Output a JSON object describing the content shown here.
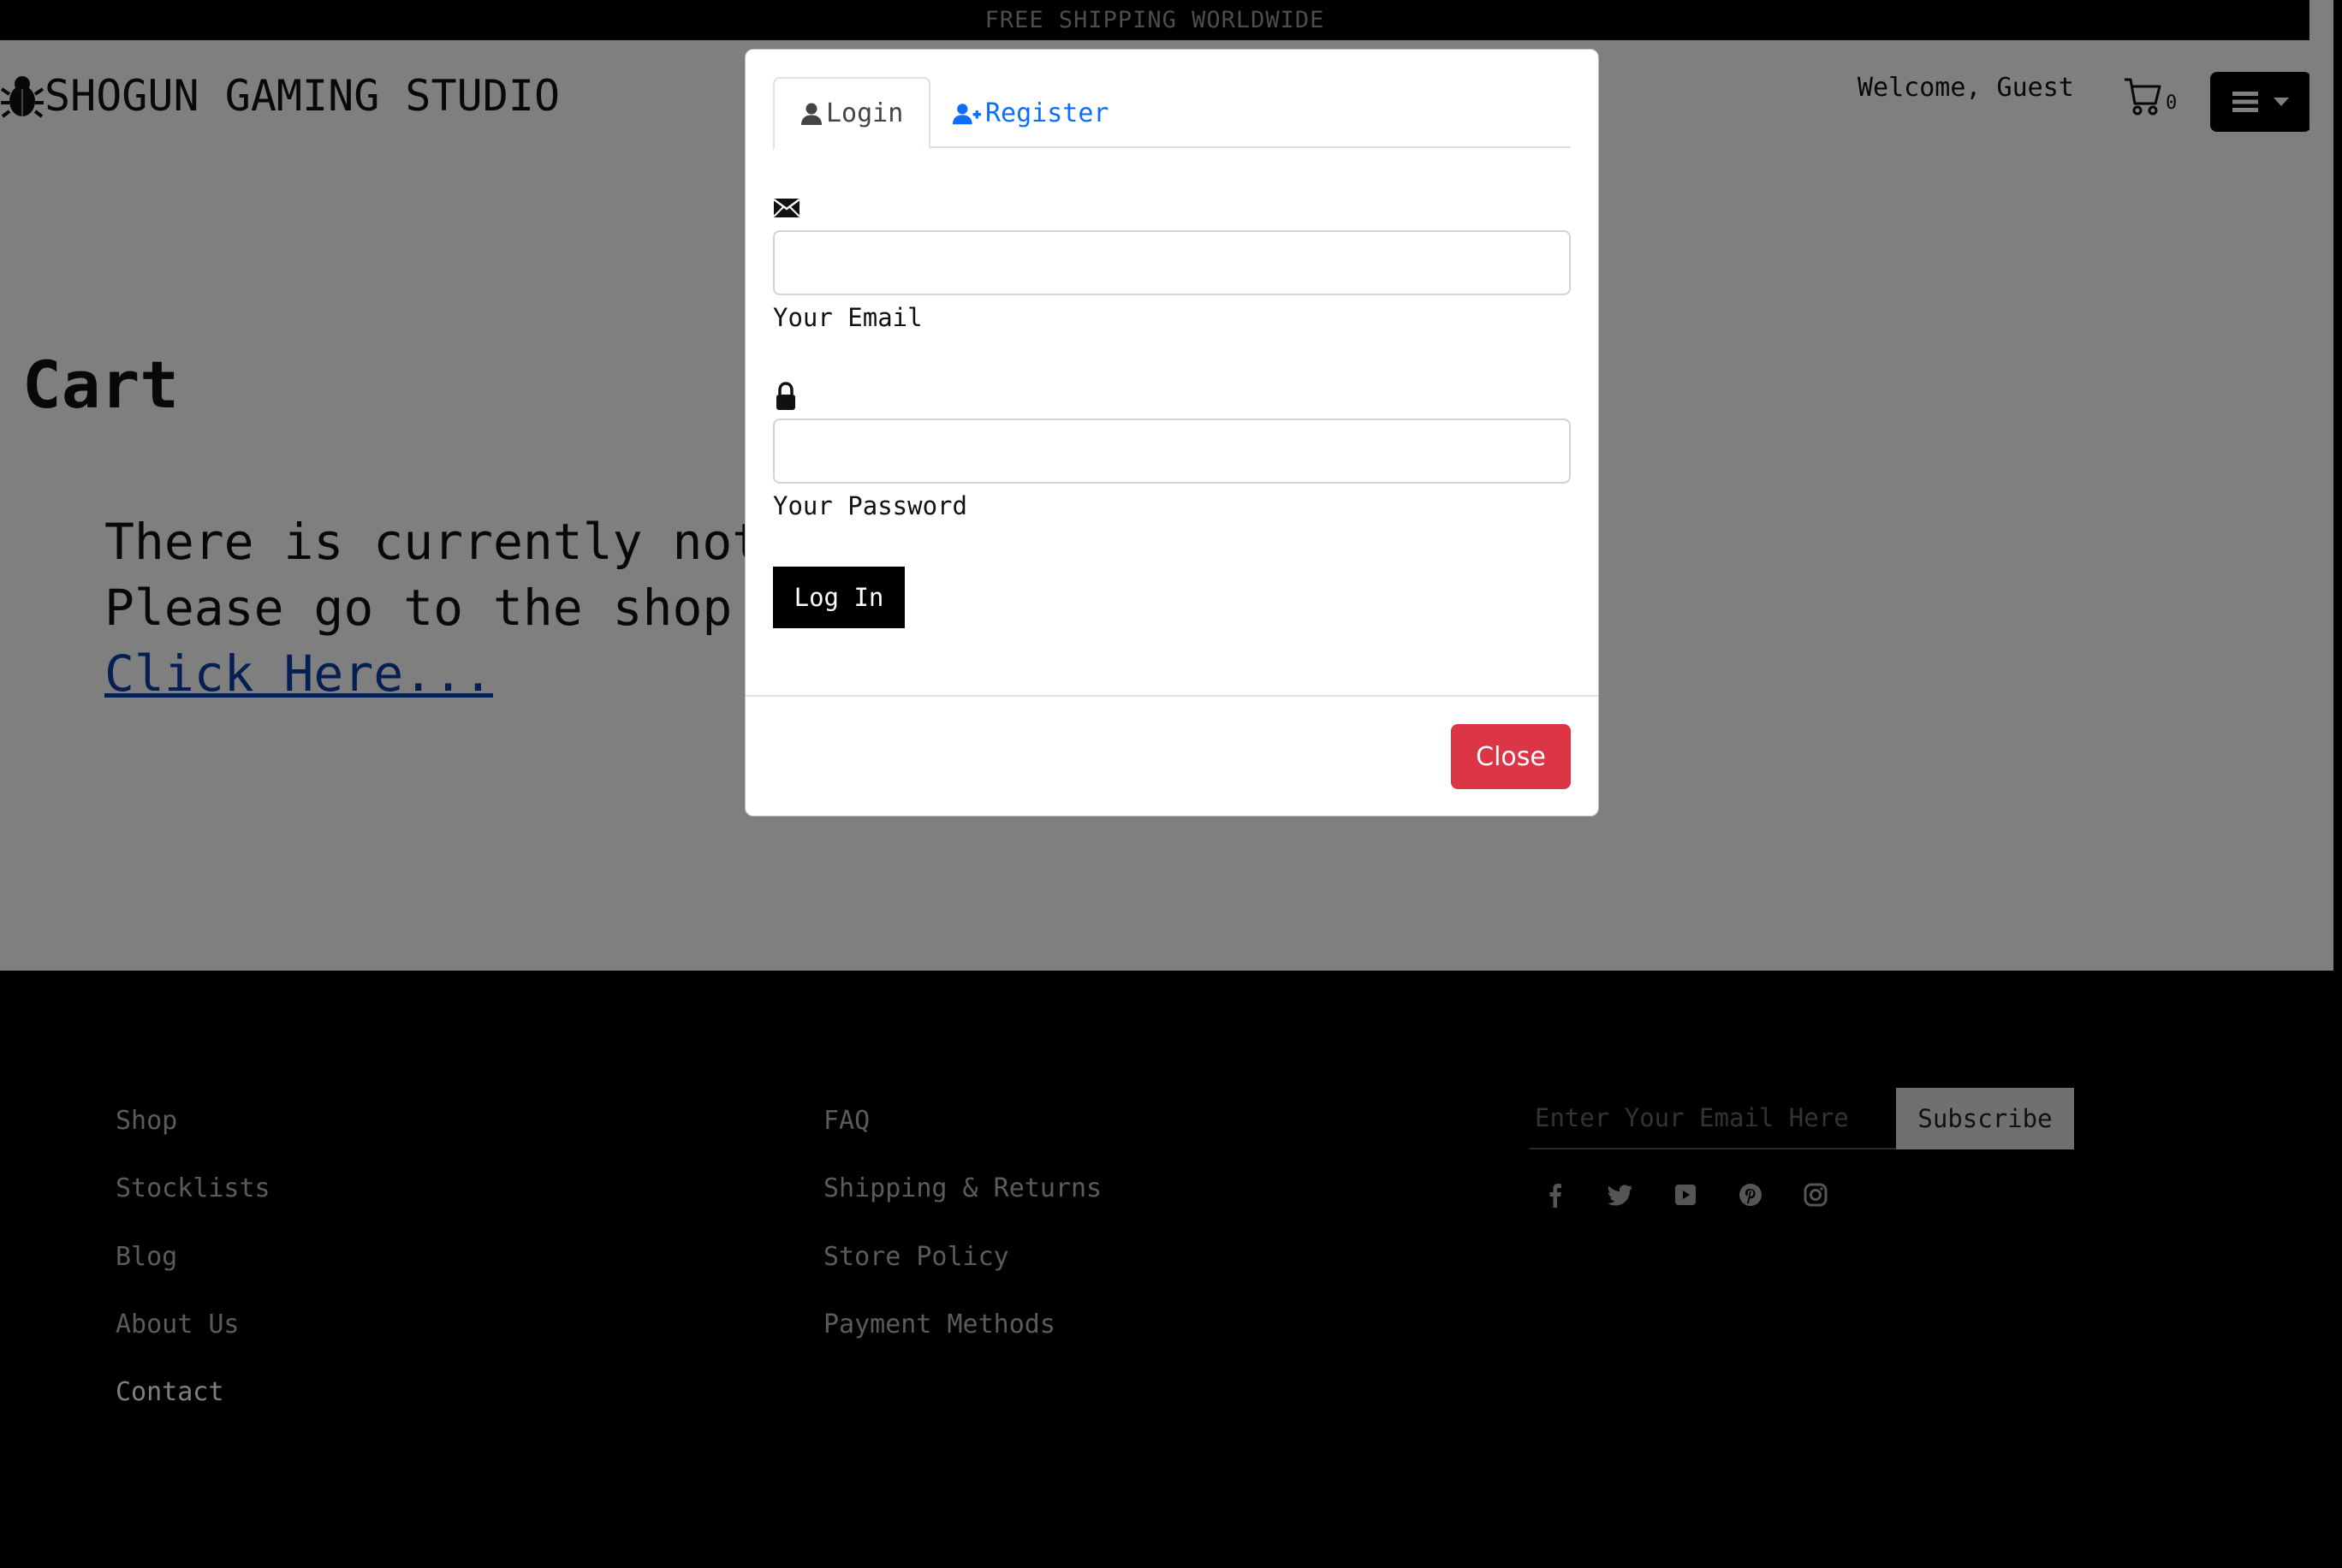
{
  "promo": {
    "text": "FREE SHIPPING WORLDWIDE"
  },
  "header": {
    "brand": "SHOGUN GAMING STUDIO",
    "brand_icon": "bug-icon",
    "welcome": "Welcome, Guest",
    "cart_count": "0"
  },
  "main": {
    "title": "Cart",
    "message_line1": "There is currently nothing in your cart",
    "message_line2": "Please go to the shop to add items to your cart",
    "link": "Click Here..."
  },
  "modal": {
    "tabs": [
      {
        "label": "Login"
      },
      {
        "label": "Register"
      }
    ],
    "email_label": "Your Email",
    "password_label": "Your Password",
    "login_button": "Log In",
    "close_button": "Close"
  },
  "footer": {
    "col1": [
      "Shop",
      "Stocklists",
      "Blog",
      "About Us",
      "Contact"
    ],
    "col2": [
      "FAQ",
      "Shipping & Returns",
      "Store Policy",
      "Payment Methods"
    ],
    "subscribe_placeholder": "Enter Your Email Here",
    "subscribe_button": "Subscribe",
    "socials": [
      "facebook-icon",
      "twitter-icon",
      "youtube-icon",
      "pinterest-icon",
      "instagram-icon"
    ]
  },
  "colors": {
    "accent_link": "#0d6efd",
    "danger": "#dc3545",
    "dark": "#000000"
  }
}
